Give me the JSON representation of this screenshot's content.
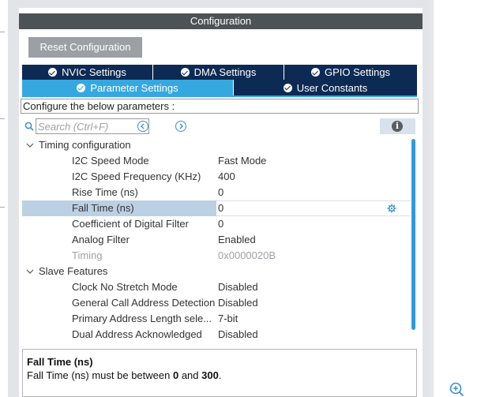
{
  "panel": {
    "title": "Configuration"
  },
  "toolbar": {
    "reset_label": "Reset Configuration"
  },
  "tabs_row1": [
    {
      "label": "NVIC Settings",
      "active": false
    },
    {
      "label": "DMA Settings",
      "active": false
    },
    {
      "label": "GPIO Settings",
      "active": false
    }
  ],
  "tabs_row2": [
    {
      "label": "Parameter Settings",
      "active": true
    },
    {
      "label": "User Constants",
      "active": false
    }
  ],
  "configure_text": "Configure the below parameters :",
  "search": {
    "placeholder": "Search (Ctrl+F)"
  },
  "groups": [
    {
      "name": "Timing configuration",
      "params": [
        {
          "name": "I2C Speed Mode",
          "value": "Fast Mode"
        },
        {
          "name": "I2C Speed Frequency (KHz)",
          "value": "400"
        },
        {
          "name": "Rise Time (ns)",
          "value": "0"
        },
        {
          "name": "Fall Time (ns)",
          "value": "0",
          "selected": true
        },
        {
          "name": "Coefficient of Digital Filter",
          "value": "0"
        },
        {
          "name": "Analog Filter",
          "value": "Enabled"
        },
        {
          "name": "Timing",
          "value": "0x0000020B",
          "disabled": true
        }
      ]
    },
    {
      "name": "Slave Features",
      "params": [
        {
          "name": "Clock No Stretch Mode",
          "value": "Disabled"
        },
        {
          "name": "General Call Address Detection",
          "value": "Disabled"
        },
        {
          "name": "Primary Address Length sele...",
          "value": "7-bit"
        },
        {
          "name": "Dual Address Acknowledged",
          "value": "Disabled"
        }
      ]
    }
  ],
  "description": {
    "title": "Fall Time (ns)",
    "text_prefix": "Fall Time (ns) must be between ",
    "min": "0",
    "text_mid": " and ",
    "max": "300",
    "text_suffix": "."
  },
  "colors": {
    "tab_inactive": "#0d2a54",
    "tab_active": "#36a8e0",
    "header": "#4d5256",
    "selection": "#bcd0e4"
  }
}
